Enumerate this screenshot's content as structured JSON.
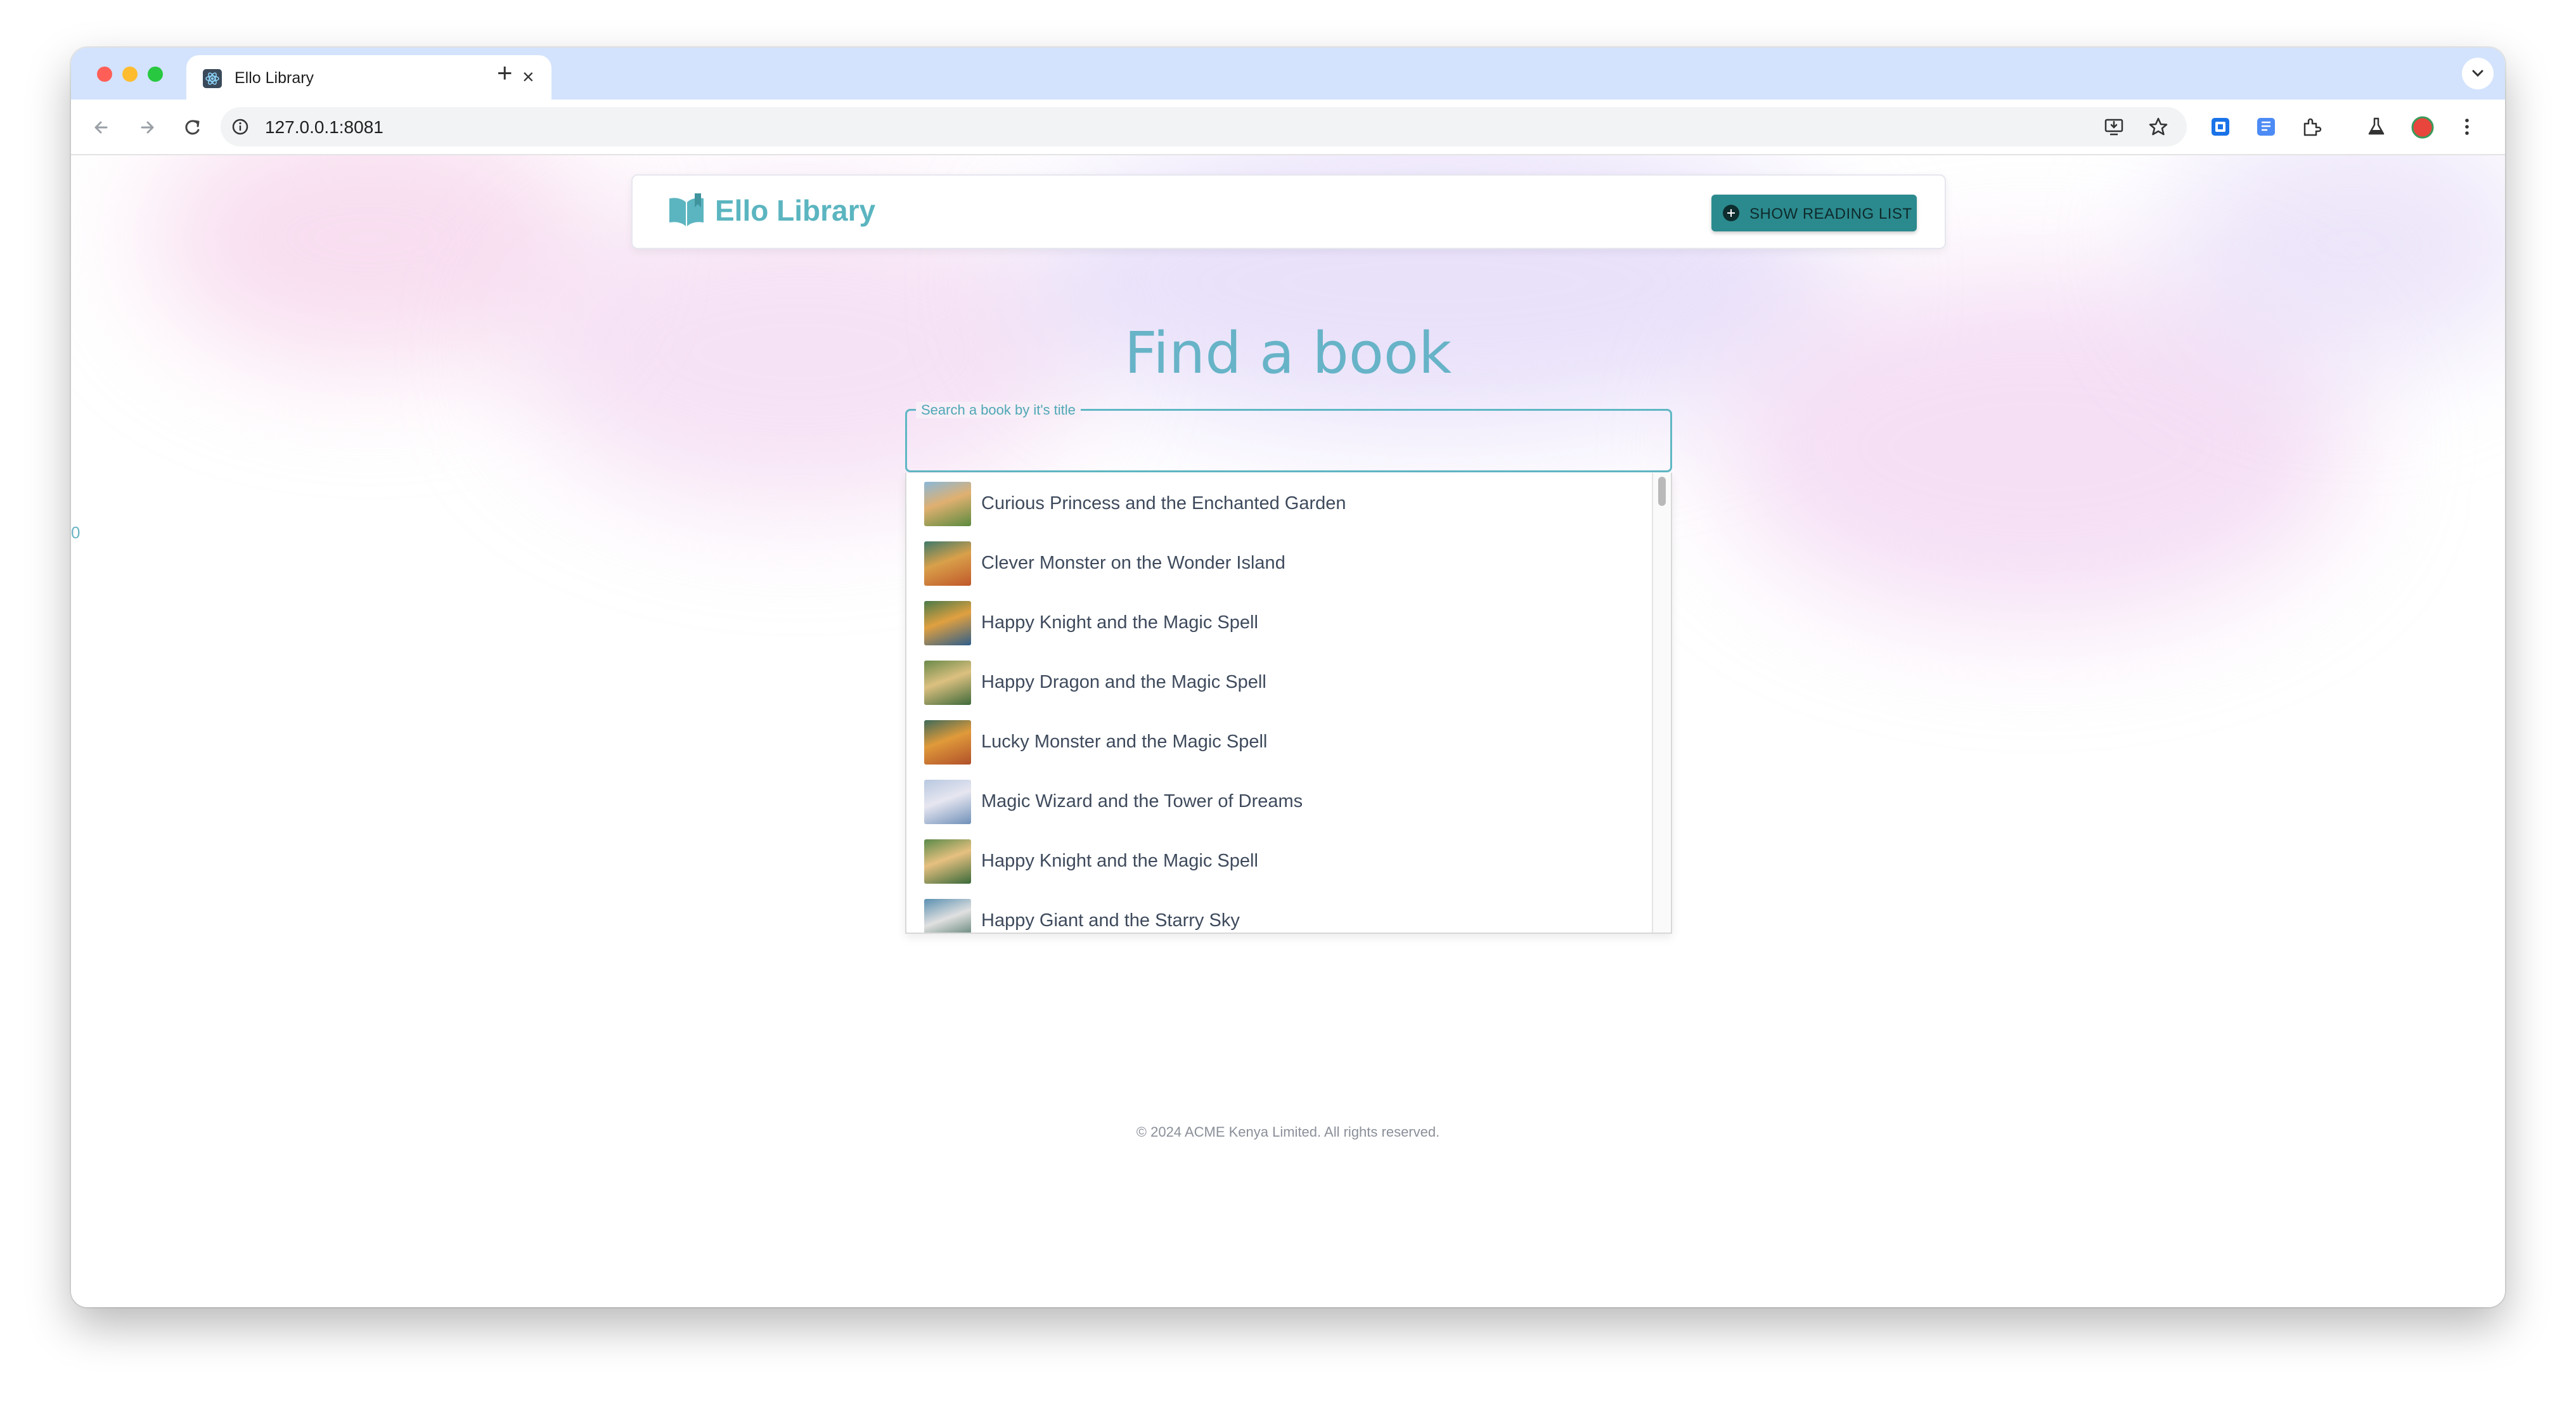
{
  "browser": {
    "tab_title": "Ello Library",
    "tab_close": "×",
    "new_tab": "+",
    "url": "127.0.0.1:8081"
  },
  "page": {
    "edge_text": "0",
    "brand": "Ello Library",
    "reading_list_button": "SHOW READING LIST",
    "heading": "Find a book",
    "search": {
      "legend": "Search a book by it's title",
      "value": ""
    },
    "books": [
      {
        "title": "Curious Princess and the Enchanted Garden",
        "palette": [
          "#8ab8d8",
          "#e0b070",
          "#5b8a3e"
        ]
      },
      {
        "title": "Clever Monster on the Wonder Island",
        "palette": [
          "#3f7a6a",
          "#d9a04a",
          "#c0582a"
        ]
      },
      {
        "title": "Happy Knight and the Magic Spell",
        "palette": [
          "#4a7a4a",
          "#e0a040",
          "#2f5e8a"
        ]
      },
      {
        "title": "Happy Dragon and the Magic Spell",
        "palette": [
          "#6a8a4a",
          "#dcc080",
          "#3f6a3a"
        ]
      },
      {
        "title": "Lucky Monster and the Magic Spell",
        "palette": [
          "#3f6a5a",
          "#e09a3a",
          "#b0502a"
        ]
      },
      {
        "title": "Magic Wizard and the Tower of Dreams",
        "palette": [
          "#b8c8e0",
          "#e6e6f0",
          "#7090b8"
        ]
      },
      {
        "title": "Happy Knight and the Magic Spell",
        "palette": [
          "#5a8a4a",
          "#e6c080",
          "#3a6a3a"
        ]
      },
      {
        "title": "Happy Giant and the Starry Sky",
        "palette": [
          "#5a90b0",
          "#e0e0e0",
          "#3f6a5a"
        ]
      }
    ],
    "footer": "© 2024 ACME Kenya Limited. All rights reserved."
  },
  "colors": {
    "accent": "#5bb5c0",
    "button_bg": "#2b8a8e",
    "heading": "#67b3c7",
    "tabbar": "#d3e3fd"
  },
  "icons": [
    "book-logo-icon",
    "add-circle-icon",
    "back-arrow-icon",
    "forward-arrow-icon",
    "reload-icon",
    "site-info-icon",
    "install-app-icon",
    "bookmark-star-icon",
    "extensions-icon",
    "labs-flask-icon",
    "profile-avatar-icon",
    "more-menu-icon"
  ]
}
